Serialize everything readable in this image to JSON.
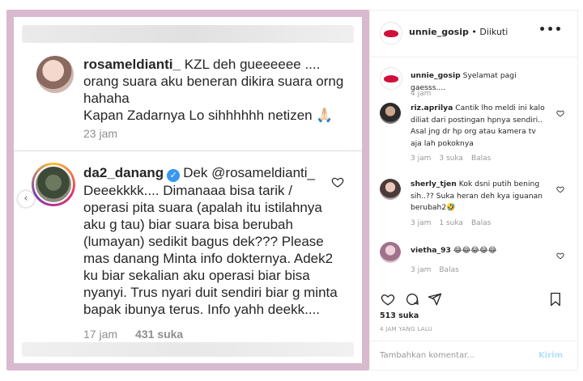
{
  "post_image": {
    "comment1": {
      "username": "rosameldianti_",
      "text": "KZL deh gueeeeee ....\norang suara aku beneran dikira suara orng\nhahaha\nKapan Zadarnya Lo sihhhhhh netizen 🙏🏻",
      "time": "23 jam"
    },
    "comment2": {
      "username": "da2_danang",
      "mention": "Dek @rosameldianti_",
      "text": "Deeekkkk.... Dimanaaa bisa tarik / operasi pita suara (apalah itu istilahnya aku g tau) biar suara bisa berubah (lumayan) sedikit bagus dek??? Please mas danang Minta info dokternya. Adek2 ku biar sekalian aku operasi biar bisa nyanyi. Trus nyari duit sendiri biar g minta bapak ibunya terus. Info yahh deekk....",
      "time": "17 jam",
      "likes": "431 suka"
    }
  },
  "header": {
    "username": "unnie_gosip",
    "follow_status": "• Diikuti",
    "menu": "•••"
  },
  "caption": {
    "username": "unnie_gosip",
    "text": "Syelamat pagi gaesss....",
    "time": "4 jam"
  },
  "comments": [
    {
      "username": "riz.aprilya",
      "text": "Cantik lho meldi ini kalo diliat dari postingan hpnya sendiri.. Asal jng dr hp org atau kamera tv aja lah pokoknya",
      "time": "3 jam",
      "likes": "3 suka",
      "reply": "Balas"
    },
    {
      "username": "sherly_tjen",
      "text": "Kok dsni putih bening sih..?? Suka heran deh kya iguanan berubah2🤣",
      "time": "3 jam",
      "likes": "1 suka",
      "reply": "Balas"
    },
    {
      "username": "vietha_93",
      "text": "😂😂😂😂😂",
      "time": "3 jam",
      "reply": "Balas"
    }
  ],
  "footer": {
    "likes": "513 suka",
    "time_ago": "4 JAM YANG LALU",
    "comment_placeholder": "Tambahkan komentar...",
    "post_label": "Kirim"
  },
  "colors": {
    "frame": "#d8b9ce",
    "brand_lips": "#d0103a",
    "verified": "#3897f0",
    "muted": "#8e8e8e"
  }
}
